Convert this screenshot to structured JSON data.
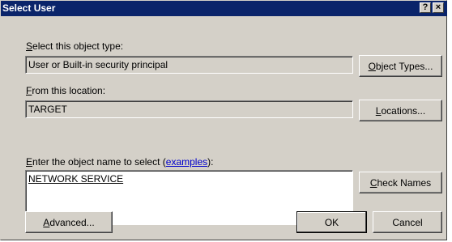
{
  "window": {
    "title": "Select User",
    "help_label": "?",
    "close_label": "×"
  },
  "object_type": {
    "label_underlined": "S",
    "label_rest": "elect this object type:",
    "value": "User or Built-in security principal",
    "button_underlined": "O",
    "button_rest": "bject Types..."
  },
  "location": {
    "label_underlined": "F",
    "label_rest": "rom this location:",
    "value": "TARGET",
    "button_underlined": "L",
    "button_rest": "ocations..."
  },
  "object_name": {
    "label_underlined": "E",
    "label_rest": "nter the object name to select (",
    "link_text": "examples",
    "label_end": "):",
    "value": "NETWORK SERVICE",
    "check_underlined": "C",
    "check_rest": "heck Names"
  },
  "footer": {
    "advanced_underlined": "A",
    "advanced_rest": "dvanced...",
    "ok_label": "OK",
    "cancel_label": "Cancel"
  }
}
